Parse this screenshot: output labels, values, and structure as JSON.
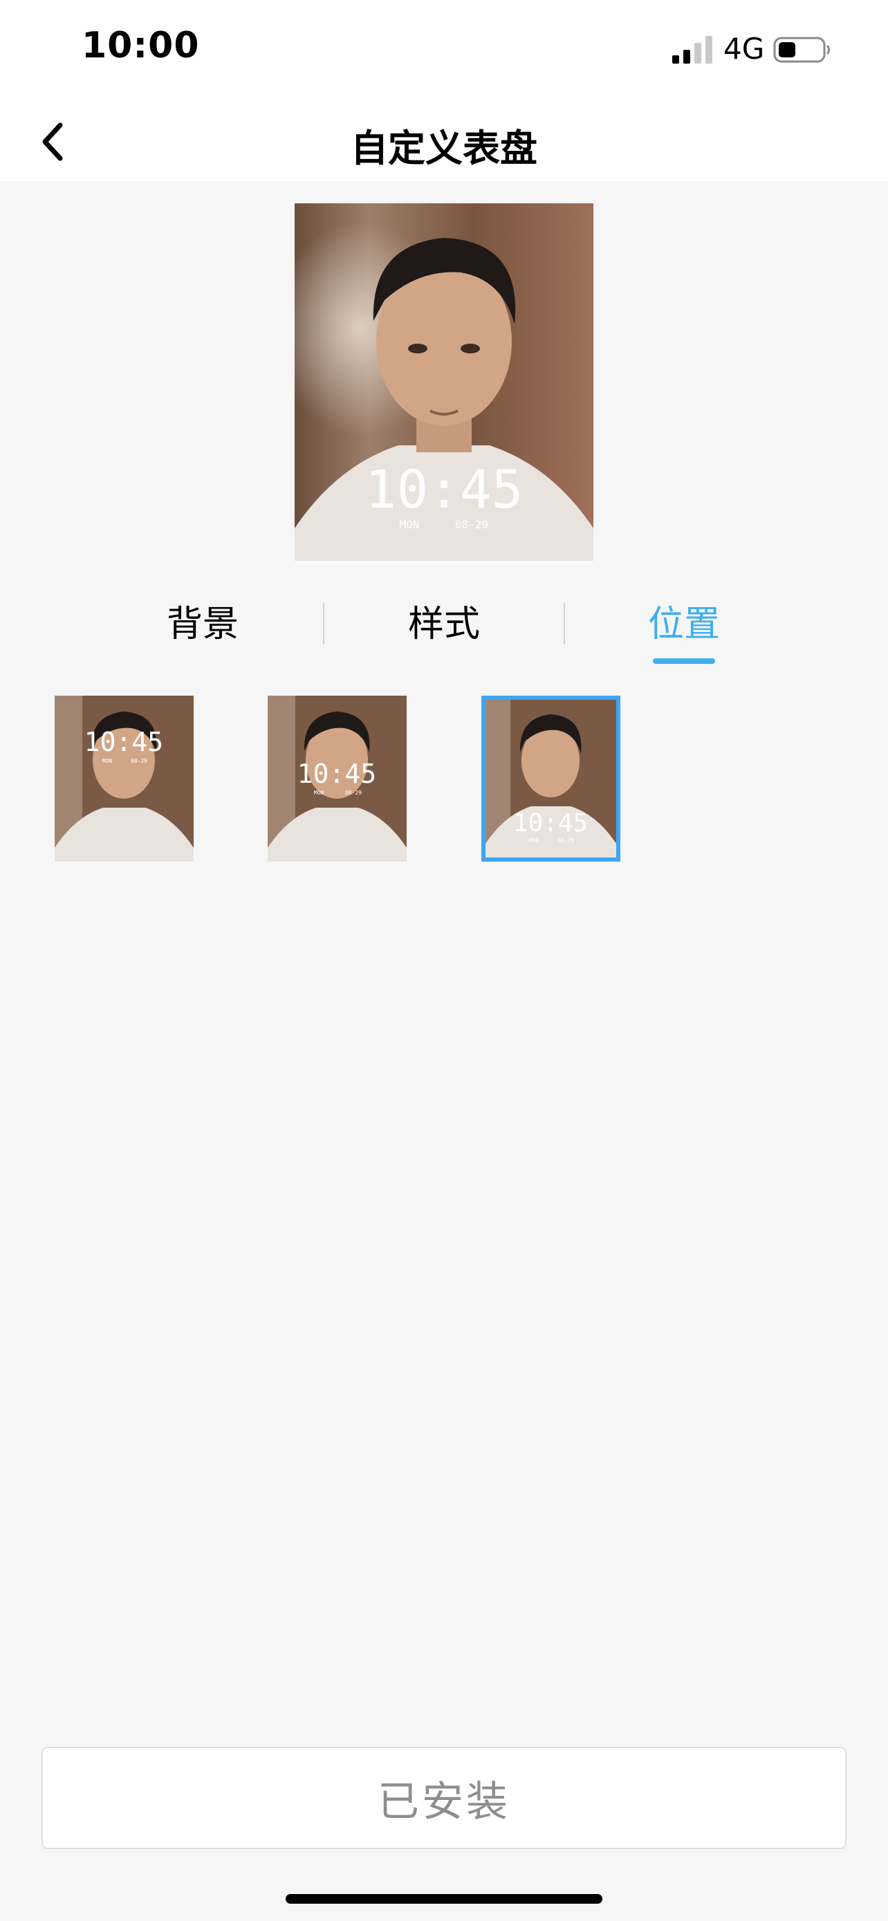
{
  "status_bar": {
    "time": "10:00",
    "network": "4G",
    "icons": [
      "signal-icon",
      "battery-icon"
    ]
  },
  "nav": {
    "title": "自定义表盘",
    "back_icon": "chevron-left-icon"
  },
  "preview": {
    "time": "10:45",
    "weekday": "MON",
    "date": "08-29",
    "clock_position": "bottom"
  },
  "tabs": [
    {
      "label": "背景",
      "active": false
    },
    {
      "label": "样式",
      "active": false
    },
    {
      "label": "位置",
      "active": true
    }
  ],
  "positions": [
    {
      "position": "top",
      "time": "10:45",
      "weekday": "MON",
      "date": "08-29",
      "selected": false
    },
    {
      "position": "middle",
      "time": "10:45",
      "weekday": "MON",
      "date": "08-29",
      "selected": false
    },
    {
      "position": "bottom",
      "time": "10:45",
      "weekday": "MON",
      "date": "08-29",
      "selected": true
    }
  ],
  "install_button": {
    "label": "已安装"
  },
  "colors": {
    "accent": "#3daef0",
    "selected_border": "#3da5f2",
    "background": "#f6f6f6"
  }
}
